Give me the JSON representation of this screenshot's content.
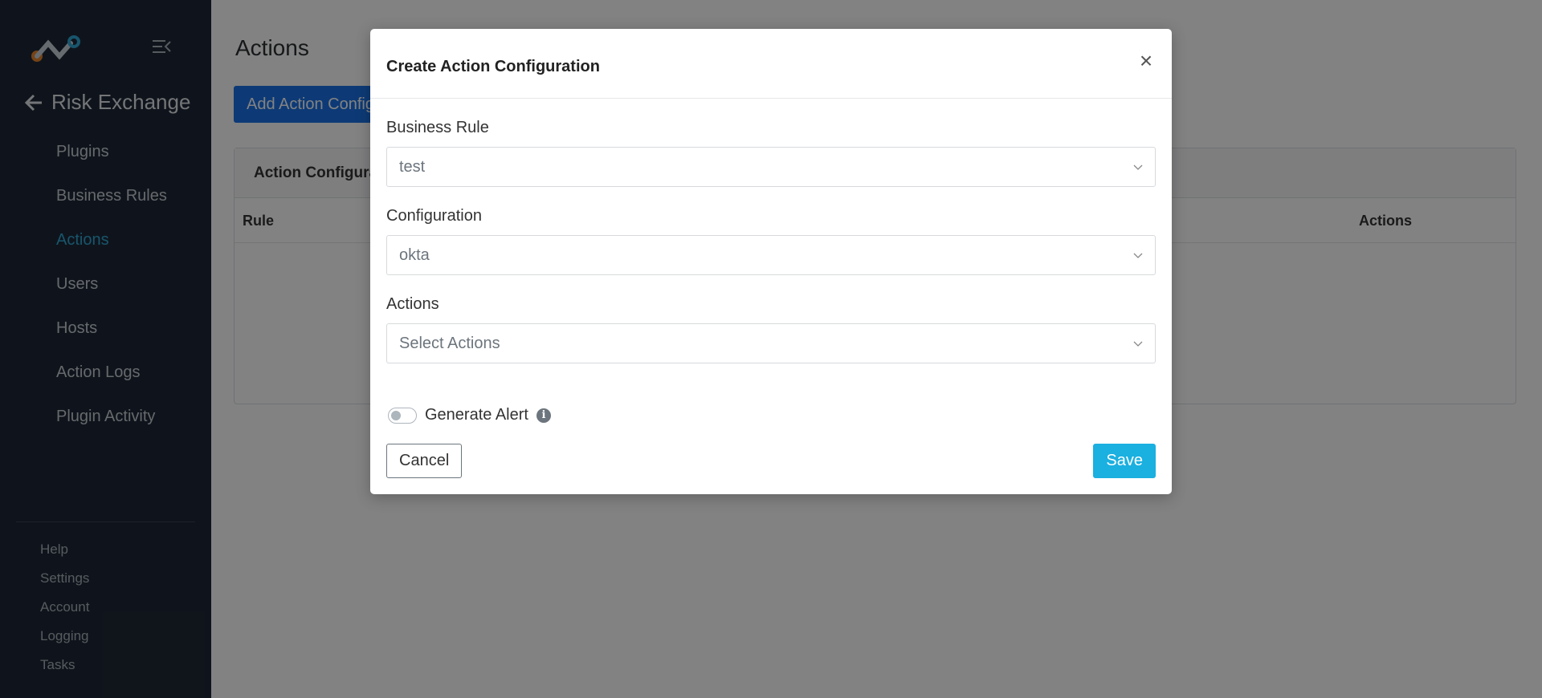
{
  "sidebar": {
    "back_title": "Risk Exchange",
    "items": [
      {
        "label": "Plugins"
      },
      {
        "label": "Business Rules"
      },
      {
        "label": "Actions",
        "active": true
      },
      {
        "label": "Users"
      },
      {
        "label": "Hosts"
      },
      {
        "label": "Action Logs"
      },
      {
        "label": "Plugin Activity"
      }
    ],
    "footer_items": [
      {
        "label": "Help"
      },
      {
        "label": "Settings"
      },
      {
        "label": "Account"
      },
      {
        "label": "Logging"
      },
      {
        "label": "Tasks"
      }
    ],
    "icons": {
      "logo": "app-logo",
      "collapse": "collapse-menu-icon",
      "back": "arrow-left-icon"
    }
  },
  "main": {
    "page_title": "Actions",
    "add_button_label": "Add Action Configuration",
    "card_title": "Action Configurations",
    "columns": [
      "Rule",
      "Actions"
    ]
  },
  "modal": {
    "title": "Create Action Configuration",
    "close_symbol": "×",
    "business_rule": {
      "label": "Business Rule",
      "value": "test"
    },
    "configuration": {
      "label": "Configuration",
      "value": "okta"
    },
    "actions": {
      "label": "Actions",
      "placeholder": "Select Actions"
    },
    "generate_alert": {
      "label": "Generate Alert",
      "enabled": false,
      "info_symbol": "i"
    },
    "cancel_label": "Cancel",
    "save_label": "Save"
  },
  "colors": {
    "sidebar_bg": "#1f2937",
    "active_nav": "#2fa8d5",
    "primary_button": "#1a73e8",
    "save_button": "#1ab0e0"
  }
}
